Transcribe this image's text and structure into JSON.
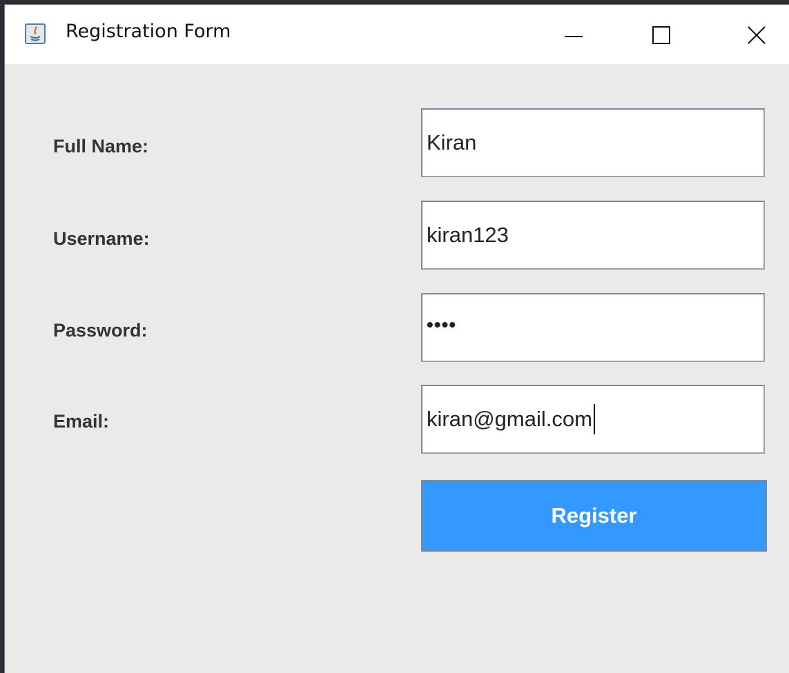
{
  "window": {
    "title": "Registration Form",
    "controls": {
      "minimize": "minimize-icon",
      "maximize": "maximize-icon",
      "close": "close-icon"
    }
  },
  "form": {
    "fields": [
      {
        "label": "Full Name:",
        "value": "Kiran"
      },
      {
        "label": "Username:",
        "value": "kiran123"
      },
      {
        "label": "Password:",
        "value": "••••"
      },
      {
        "label": "Email:",
        "value": "kiran@gmail.com"
      }
    ],
    "submit_label": "Register"
  },
  "colors": {
    "background": "#eaeaea",
    "titlebar": "#ffffff",
    "button": "#3399ff",
    "label_text": "#333333"
  }
}
